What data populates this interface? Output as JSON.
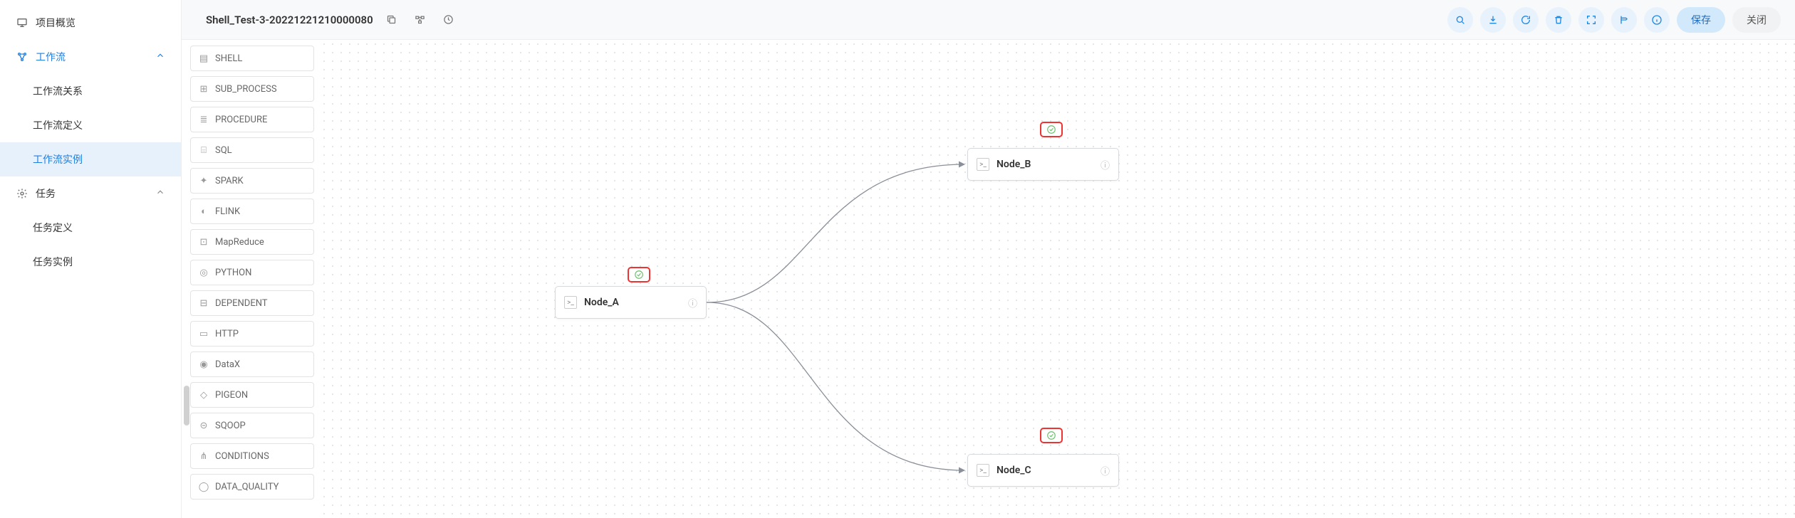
{
  "sidebar": {
    "overview": "项目概览",
    "workflow": "工作流",
    "children": {
      "relation": "工作流关系",
      "definition": "工作流定义",
      "instance": "工作流实例"
    },
    "task": "任务",
    "task_children": {
      "definition": "任务定义",
      "instance": "任务实例"
    }
  },
  "header": {
    "title": "Shell_Test-3-20221221210000080",
    "save": "保存",
    "close": "关闭"
  },
  "palette": {
    "items": [
      "SHELL",
      "SUB_PROCESS",
      "PROCEDURE",
      "SQL",
      "SPARK",
      "FLINK",
      "MapReduce",
      "PYTHON",
      "DEPENDENT",
      "HTTP",
      "DataX",
      "PIGEON",
      "SQOOP",
      "CONDITIONS",
      "DATA_QUALITY"
    ]
  },
  "nodes": {
    "a": "Node_A",
    "b": "Node_B",
    "c": "Node_C"
  }
}
